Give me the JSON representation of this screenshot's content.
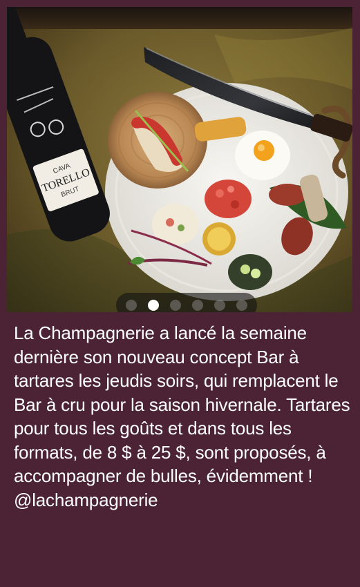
{
  "post": {
    "carousel": {
      "page_count": 6,
      "active_index": 1
    },
    "caption_text": "La Champagnerie a lancé la semaine dernière son nouveau concept Bar à tartares les jeudis soirs, qui remplacent le Bar à cru pour la saison hivernale. Tartares pour tous les goûts et dans tous les formats, de 8 $ à 25 $, sont proposés, à accompagner de bulles, évidemment ! @lachampagnerie"
  },
  "bottle_label": {
    "brand": "TORELLO",
    "type": "CAVA",
    "style": "BRUT"
  },
  "colors": {
    "background": "#4b2334",
    "caption_text": "#ffffff",
    "dot_active": "#ffffff",
    "dot_inactive": "#8f8f8f"
  }
}
